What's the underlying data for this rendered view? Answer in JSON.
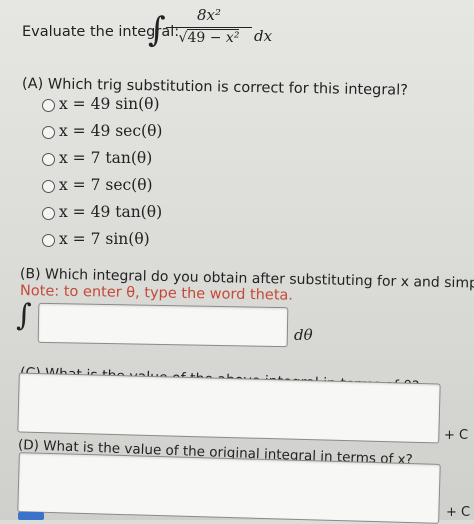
{
  "header": {
    "prompt": "Evaluate the integral:",
    "integral_sign": "∫",
    "numerator": "8x²",
    "denominator_sqrt": "√",
    "denominator_a": "49 − ",
    "denominator_b": "x²",
    "differential": "dx"
  },
  "part_a": {
    "question": "(A) Which trig substitution is correct for this integral?",
    "options": [
      "x = 49 sin(θ)",
      "x = 49 sec(θ)",
      "x = 7 tan(θ)",
      "x = 7 sec(θ)",
      "x = 49 tan(θ)",
      "x = 7 sin(θ)"
    ]
  },
  "part_b": {
    "question": "(B) Which integral do you obtain after substituting for x and simplifying?",
    "note": "Note: to enter θ, type the word theta.",
    "integral_sign": "∫",
    "suffix": "dθ",
    "answer": ""
  },
  "part_c": {
    "question": "(C) What is the value of the above integral in terms of θ?",
    "suffix": "+ C",
    "answer": ""
  },
  "part_d": {
    "question": "(D) What is the value of the original integral in terms of x?",
    "suffix": "+ C",
    "answer": ""
  }
}
